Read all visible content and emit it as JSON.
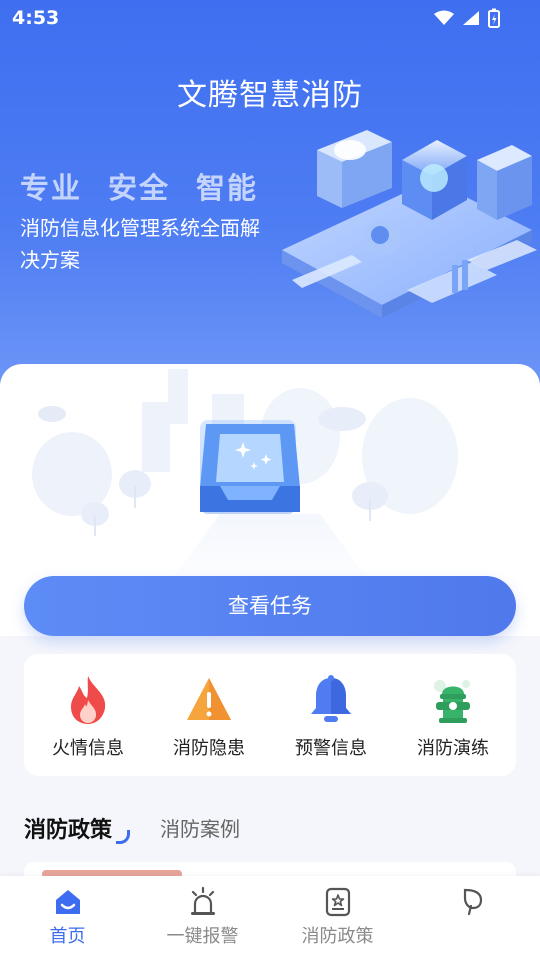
{
  "status_bar": {
    "time": "4:53"
  },
  "header": {
    "title": "文腾智慧消防",
    "tagline": [
      "专业",
      "安全",
      "智能"
    ],
    "subtitle": "消防信息化管理系统全面解决方案"
  },
  "task": {
    "button_label": "查看任务"
  },
  "quick_actions": [
    {
      "label": "火情信息",
      "icon": "flame-icon",
      "color": "#ef4b4b"
    },
    {
      "label": "消防隐患",
      "icon": "warning-icon",
      "color": "#f19a35"
    },
    {
      "label": "预警信息",
      "icon": "bell-icon",
      "color": "#4f7cf0"
    },
    {
      "label": "消防演练",
      "icon": "hydrant-icon",
      "color": "#38b36a"
    }
  ],
  "news_tabs": [
    {
      "label": "消防政策",
      "active": true
    },
    {
      "label": "消防案例",
      "active": false
    }
  ],
  "bottom_nav": [
    {
      "label": "首页",
      "icon": "home-icon",
      "active": true
    },
    {
      "label": "一键报警",
      "icon": "alarm-icon",
      "active": false
    },
    {
      "label": "消防政策",
      "icon": "policy-icon",
      "active": false
    },
    {
      "label": "",
      "icon": "leaf-icon",
      "active": false
    }
  ],
  "colors": {
    "primary": "#3d6cf0",
    "hero_gradient_top": "#3f6ff0",
    "hero_gradient_bottom": "#6f98f6"
  }
}
